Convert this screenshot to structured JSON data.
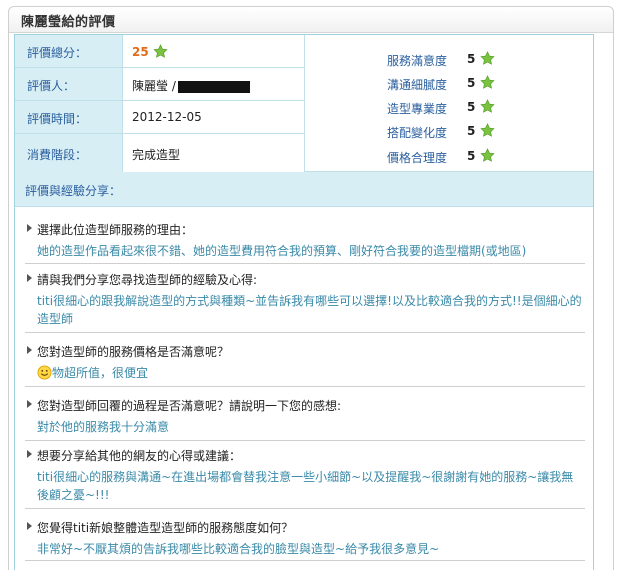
{
  "panel": {
    "title": "陳麗瑩給的評價"
  },
  "info": {
    "rows": [
      {
        "label": "評價總分：",
        "value": "25"
      },
      {
        "label": "評價人：",
        "value": "陳麗瑩 /"
      },
      {
        "label": "評價時間：",
        "value": "2012-12-05"
      },
      {
        "label": "消費階段：",
        "value": "完成造型"
      }
    ]
  },
  "ratings": [
    {
      "label": "服務滿意度",
      "value": "5"
    },
    {
      "label": "溝通細膩度",
      "value": "5"
    },
    {
      "label": "造型專業度",
      "value": "5"
    },
    {
      "label": "搭配變化度",
      "value": "5"
    },
    {
      "label": "價格合理度",
      "value": "5"
    }
  ],
  "section": {
    "title": "評價與經驗分享："
  },
  "qa": [
    {
      "q": "選擇此位造型師服務的理由：",
      "a": "她的造型作品看起來很不錯、她的造型費用符合我的預算、剛好符合我要的造型檔期(或地區)"
    },
    {
      "q": "請與我們分享您尋找造型師的經驗及心得:",
      "a": "titi很細心的跟我解說造型的方式與種類~並告訴我有哪些可以選擇!以及比較適合我的方式!!是個細心的造型師"
    },
    {
      "q": "您對造型師的服務價格是否滿意呢？",
      "a": "物超所值，很便宜"
    },
    {
      "q": "您對造型師回覆的過程是否滿意呢？請說明一下您的感想:",
      "a": "對於他的服務我十分滿意"
    },
    {
      "q": "想要分享給其他的網友的心得或建議：",
      "a": "titi很細心的服務與溝通~在進出場都會替我注意一些小細節~以及提醒我~很謝謝有她的服務~讓我無後顧之憂~!!!"
    },
    {
      "q": "您覺得titi新娘整體造型造型師的服務態度如何？",
      "a": "非常好~不厭其煩的告訴我哪些比較適合我的臉型與造型~給予我很多意見~"
    }
  ],
  "icons": {
    "star": "green-star-icon",
    "smile": "smile-icon"
  },
  "colors": {
    "label_bg": "#d8eef5",
    "label_text": "#2a5f9e",
    "answer_text": "#3a8aa8",
    "score": "#e06b1a",
    "star": "#7cc242"
  }
}
